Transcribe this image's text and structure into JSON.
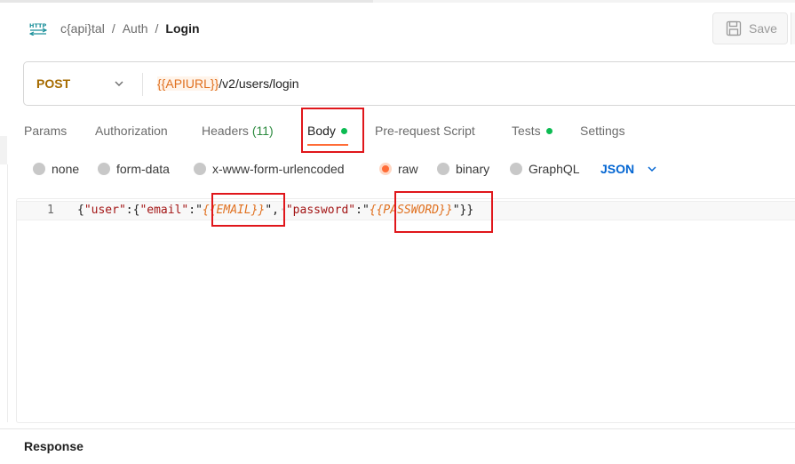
{
  "header": {
    "protocol_icon": "http-swap-icon",
    "breadcrumb": {
      "collection": "c{api}tal",
      "folder": "Auth",
      "request": "Login",
      "separator": "/"
    },
    "save_label": "Save",
    "save_icon": "save-icon"
  },
  "request": {
    "method": "POST",
    "method_color": "#a66b00",
    "url_variable": "{{APIURL}}",
    "url_path": "/v2/users/login"
  },
  "tabs": [
    {
      "label": "Params"
    },
    {
      "label": "Authorization"
    },
    {
      "label": "Headers",
      "count": "(11)"
    },
    {
      "label": "Body",
      "active": true,
      "indicator": true
    },
    {
      "label": "Pre-request Script"
    },
    {
      "label": "Tests",
      "indicator": true
    },
    {
      "label": "Settings"
    }
  ],
  "body_types": {
    "options": [
      "none",
      "form-data",
      "x-www-form-urlencoded",
      "raw",
      "binary",
      "GraphQL"
    ],
    "selected": "raw",
    "format": "JSON"
  },
  "editor": {
    "line_number": "1",
    "tokens": {
      "open": "{",
      "user_key": "\"user\"",
      "colon1": ":{",
      "email_key": "\"email\"",
      "colon2": ":\"",
      "email_var": "{{EMAIL}}",
      "close_quote1": "\",",
      "space_marker": "·",
      "password_key": "\"password\"",
      "colon3": ":\"",
      "password_var": "{{PASSWORD}}",
      "close": "\"}}"
    }
  },
  "response": {
    "label": "Response"
  },
  "colors": {
    "accent": "#ff6c37",
    "active_dot": "#0cbb52",
    "annotation": "#e0161b",
    "json_blue": "#0265d2",
    "variable": "#e0701f"
  }
}
